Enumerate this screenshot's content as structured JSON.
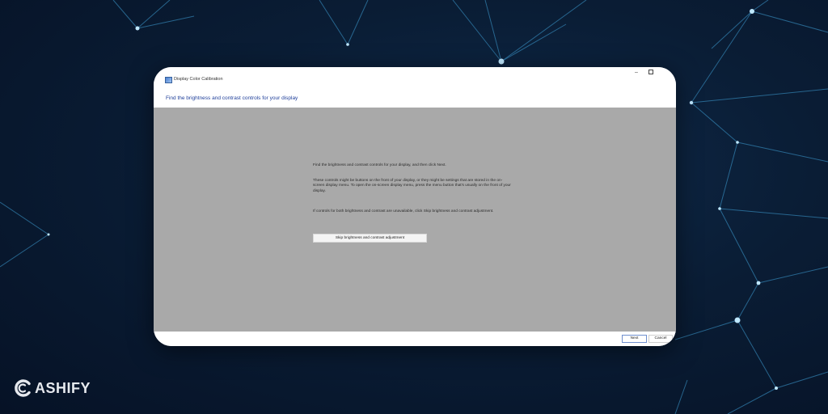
{
  "window": {
    "app_title": "Display Color Calibration",
    "icon": "display-calibration-icon",
    "controls": {
      "minimize": "–",
      "maximize": "maximize-icon"
    },
    "heading": "Find the brightness and contrast controls for your display"
  },
  "content": {
    "paragraph_1": "Find the brightness and contrast controls for your display, and then click Next.",
    "paragraph_2": "These controls might be buttons on the front of your display, or they might be settings that are stored in the on-screen display menu. To open the on-screen display menu, press the menu button that's usually on the front of your display.",
    "paragraph_3": "If controls for both brightness and contrast are unavailable, click Skip brightness and contrast adjustment.",
    "skip_button": "Skip brightness and contrast adjustment"
  },
  "footer": {
    "next_button": "Next",
    "cancel_button": "Cancel"
  },
  "watermark": {
    "brand": "ASHIFY",
    "icon": "cashify-logo-icon"
  },
  "colors": {
    "background": "#0a1d35",
    "content_gray": "#a9a9a9",
    "heading_blue": "#1f3f9a",
    "network_line": "#3fa3d9",
    "node_glow": "#bfe8ff"
  }
}
